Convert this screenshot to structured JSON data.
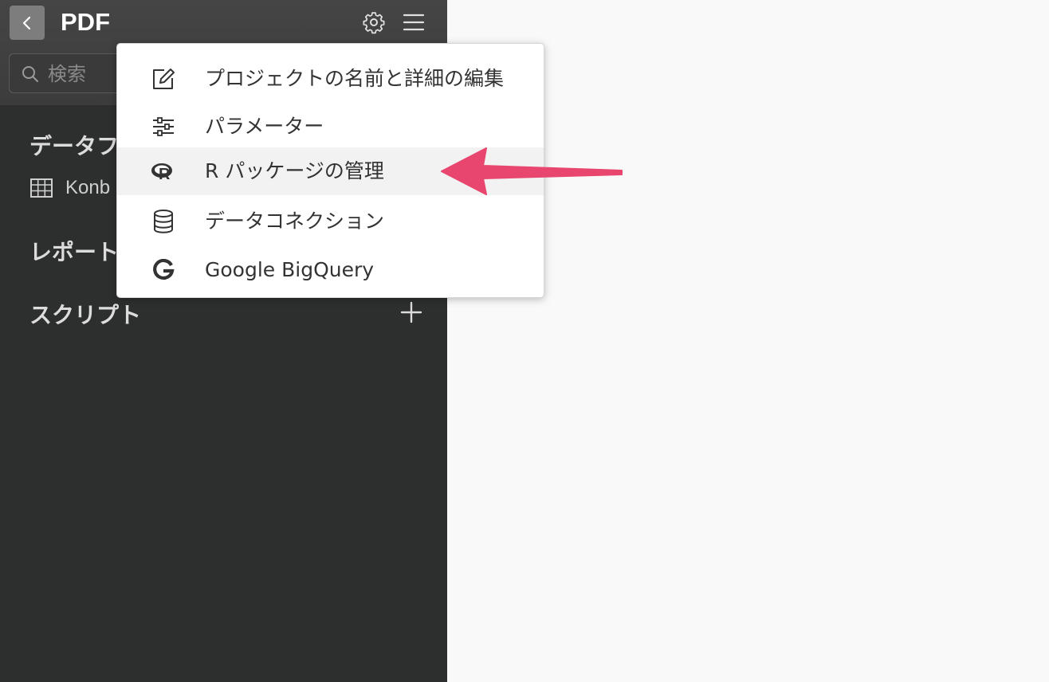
{
  "header": {
    "title": "PDF"
  },
  "search": {
    "placeholder": "検索"
  },
  "sidebar": {
    "sections": [
      {
        "label": "データフ"
      },
      {
        "label": "レポート"
      },
      {
        "label": "スクリプト"
      }
    ],
    "data_items": [
      {
        "label": "Konb"
      }
    ]
  },
  "menu": {
    "items": [
      {
        "icon": "edit-icon",
        "label": "プロジェクトの名前と詳細の編集"
      },
      {
        "icon": "sliders-icon",
        "label": "パラメーター"
      },
      {
        "icon": "r-logo-icon",
        "label": "R パッケージの管理"
      },
      {
        "icon": "database-icon",
        "label": "データコネクション"
      },
      {
        "icon": "google-icon",
        "label": "Google BigQuery"
      }
    ]
  },
  "colors": {
    "arrow": "#e8466e",
    "sidebar_bg": "#2d2e2e",
    "header_bg": "#404040"
  }
}
